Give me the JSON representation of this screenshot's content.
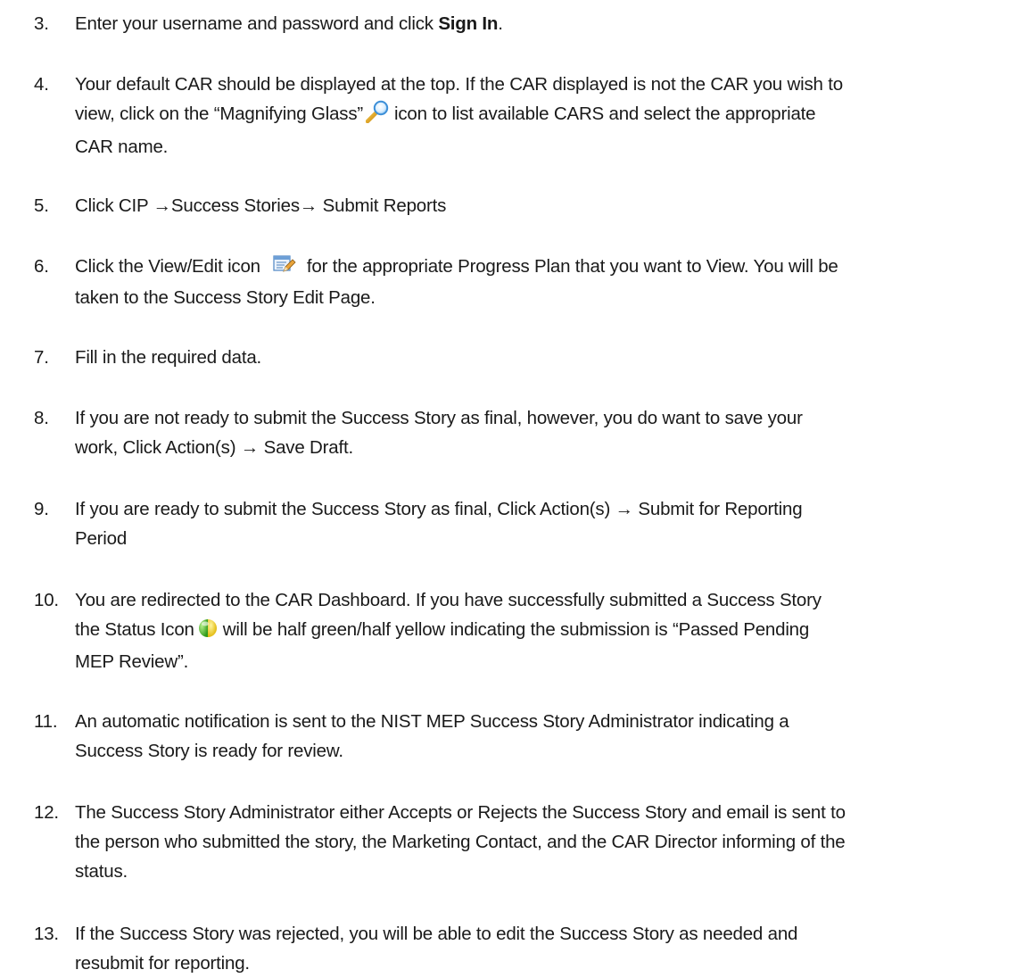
{
  "steps": [
    {
      "number": "3.",
      "lines": [
        {
          "before": "Enter your username and password and click ",
          "bold": "Sign In",
          "after": "."
        }
      ]
    },
    {
      "number": "4.",
      "lines": [
        {
          "text": "Your default CAR should be displayed at the top. If the CAR displayed is not the CAR you wish to"
        },
        {
          "before": "view, click on the “Magnifying Glass”",
          "icon": "magnifying-glass-icon",
          "after": "icon to list available CARS and select the appropriate"
        },
        {
          "text": "CAR name."
        }
      ]
    },
    {
      "number": "5.",
      "lines": [
        {
          "text": "Click CIP →Success Stories→ Submit Reports"
        }
      ]
    },
    {
      "number": "6.",
      "lines": [
        {
          "before": "Click the View/Edit icon",
          "icon": "view-edit-icon",
          "after": "for the appropriate Progress Plan that you want to View. You will be"
        },
        {
          "text": "taken to the Success Story Edit Page."
        }
      ]
    },
    {
      "number": "7.",
      "lines": [
        {
          "text": "Fill in the required data."
        }
      ]
    },
    {
      "number": "8.",
      "lines": [
        {
          "text": "If you are not ready to submit the Success Story as final, however, you do want to save your"
        },
        {
          "text": "work, Click Action(s) → Save Draft."
        }
      ]
    },
    {
      "number": "9.",
      "lines": [
        {
          "text": "If you are ready to submit the Success Story as final, Click Action(s) → Submit for Reporting"
        },
        {
          "text": "Period"
        }
      ]
    },
    {
      "number": "10.",
      "lines": [
        {
          "text": "You are redirected to the CAR Dashboard. If you have successfully submitted a Success Story"
        },
        {
          "before": "the Status Icon",
          "icon": "status-icon",
          "after": "will be half green/half yellow indicating the submission is “Passed Pending"
        },
        {
          "text": "MEP Review”."
        }
      ]
    },
    {
      "number": "11.",
      "lines": [
        {
          "text": "An automatic notification is sent to the NIST MEP Success Story Administrator indicating a"
        },
        {
          "text": "Success Story is ready for review."
        }
      ]
    },
    {
      "number": "12.",
      "lines": [
        {
          "text": "The Success Story Administrator either Accepts or Rejects the Success Story and email is sent to"
        },
        {
          "text": "the person who submitted the story, the Marketing Contact, and the CAR Director informing of the"
        },
        {
          "text": "status."
        }
      ]
    },
    {
      "number": "13.",
      "lines": [
        {
          "text": "If the Success Story was rejected, you will be able to edit the Success Story as needed and"
        },
        {
          "text": "resubmit for reporting."
        }
      ]
    }
  ]
}
